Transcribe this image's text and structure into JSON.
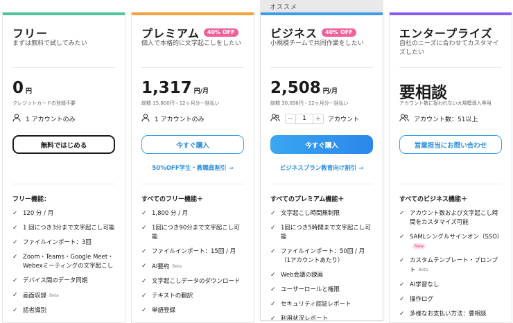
{
  "colors": {
    "free": "#4cc69a",
    "premium": "#f6a23a",
    "business": "#3a9cf0",
    "enterprise": "#8a5cf0",
    "link": "#2b8fdf",
    "badge": "#f2609b"
  },
  "recommended_label": "オススメ",
  "plans": [
    {
      "name": "フリー",
      "desc": "まずは無料で試してみたい",
      "price": "0",
      "unit": "円",
      "note": "クレジットカードの登録不要",
      "accounts": "1 アカウントのみ",
      "button": "無料ではじめる",
      "features_head": "フリー機能：",
      "features": [
        {
          "text": "120 分 / 月"
        },
        {
          "text": "1 回につき3分まで文字起こし可能"
        },
        {
          "text": "ファイルインポート：3回"
        },
        {
          "text": "Zoom・Teams・Google Meet・Webexミーティングの文字起こし"
        },
        {
          "text": "デバイス間のデータ同期"
        },
        {
          "text": "画面収録",
          "tag": "Beta"
        },
        {
          "text": "話者識別"
        }
      ]
    },
    {
      "name": "プレミアム",
      "badge": "40% OFF",
      "desc": "個人で本格的に文字起こしをしたい",
      "price": "1,317",
      "unit": "円/月",
      "note": "総額 15,800円・12ヶ月分一括払い",
      "accounts": "1 アカウントのみ",
      "button": "今すぐ購入",
      "sublink": "50%OFF学生・教職員割引 →",
      "features_head": "すべてのフリー機能＋",
      "features": [
        {
          "text": "1,800 分 / 月"
        },
        {
          "text": "1回につき90分まで文字起こし可能"
        },
        {
          "text": "ファイルインポート：15回 / 月"
        },
        {
          "text": "AI要約",
          "tag": "Beta"
        },
        {
          "text": "文字起こしデータのダウンロード"
        },
        {
          "text": "テキストの翻訳"
        },
        {
          "text": "単語登録"
        }
      ]
    },
    {
      "name": "ビジネス",
      "badge": "40% OFF",
      "desc": "小規模チームで共同作業をしたい",
      "price": "2,508",
      "unit": "円/月",
      "note": "総額 30,096円・12ヶ月分一括払い",
      "stepper": {
        "minus": "−",
        "qty": "1",
        "plus": "+"
      },
      "accounts": "アカウント",
      "button": "今すぐ購入",
      "sublink": "ビジネスプラン教育向け割引 →",
      "features_head": "すべてのプレミアム機能＋",
      "features": [
        {
          "text": "文字起こし時間無制限"
        },
        {
          "text": "1回につき5時間まで文字起こし可能"
        },
        {
          "text": "ファイルインポート：50回 / 月（1アカウントあたり）"
        },
        {
          "text": "Web会議の録画"
        },
        {
          "text": "ユーザーロールと権限"
        },
        {
          "text": "セキュリティ認証レポート"
        },
        {
          "text": "利用状況レポート"
        }
      ]
    },
    {
      "name": "エンタープライズ",
      "desc": "自社のニーズに合わせてカスタマイズしたい",
      "price": "要相談",
      "note": "アカウント数に捉われない大規模導入専用",
      "accounts": "アカウント数：51以上",
      "button": "営業担当にお問い合わせ",
      "features_head": "すべてのビジネス機能＋",
      "features": [
        {
          "text": "アカウント数および文字起こし時間をカスタマイズ可能"
        },
        {
          "text": "SAMLシングルサインオン（SSO）",
          "tag": "New"
        },
        {
          "text": "カスタムテンプレート・プロンプト",
          "tag": "Beta"
        },
        {
          "text": "AI学習なし"
        },
        {
          "text": "操作ログ"
        },
        {
          "text": "多様なお支払い方法：要相談"
        }
      ]
    }
  ]
}
